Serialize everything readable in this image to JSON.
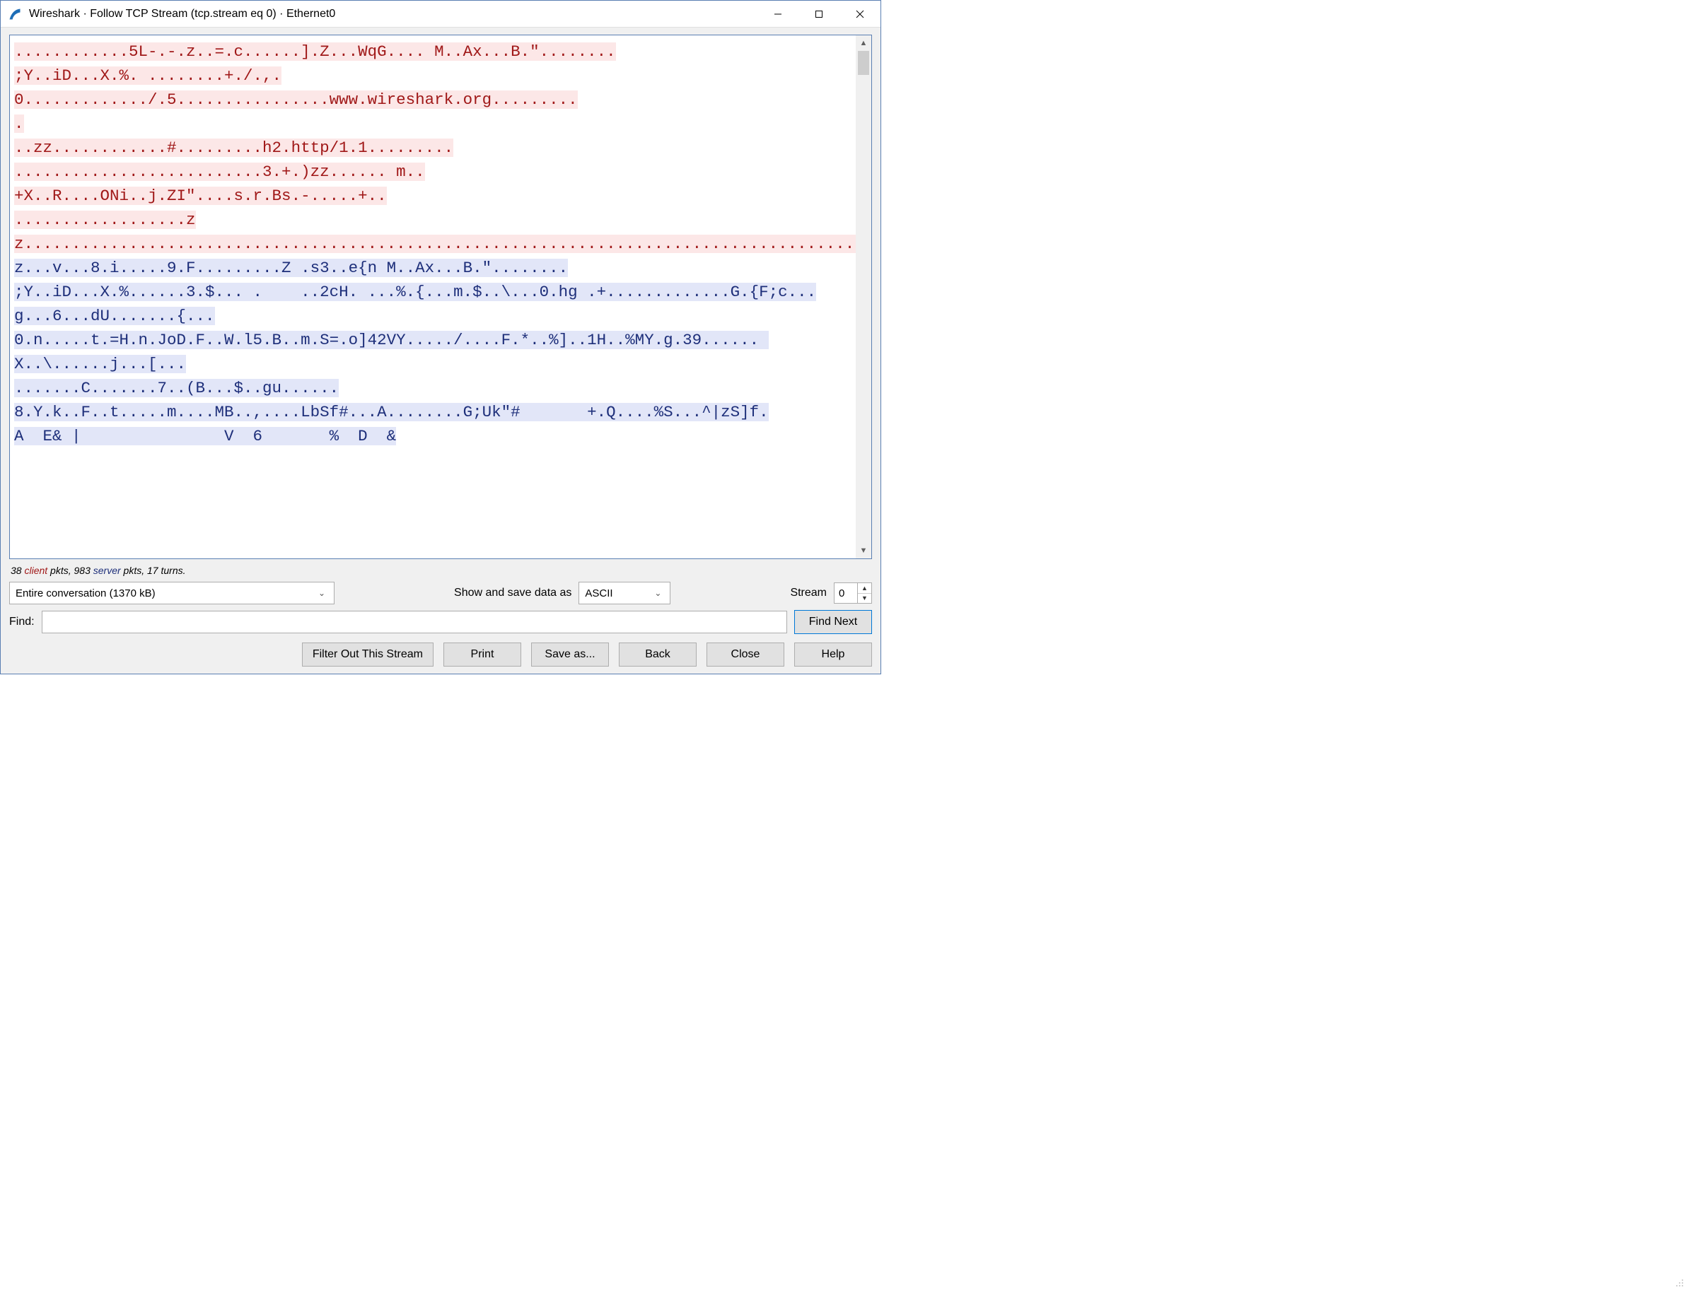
{
  "title": "Wireshark · Follow TCP Stream (tcp.stream eq 0) · Ethernet0",
  "stream_segments": [
    {
      "role": "cli",
      "text": "............5L-.-.z..=.c......].Z...WqG.... M..Ax...B.\"........"
    },
    {
      "role": "txt",
      "text": "\n"
    },
    {
      "role": "cli",
      "text": ";Y..iD...X.%. ........+./.,."
    },
    {
      "role": "txt",
      "text": "\n"
    },
    {
      "role": "cli",
      "text": "0............./.5................www.wireshark.org........."
    },
    {
      "role": "txt",
      "text": "\n"
    },
    {
      "role": "cli",
      "text": "."
    },
    {
      "role": "txt",
      "text": "\n"
    },
    {
      "role": "cli",
      "text": "..zz............#.........h2.http/1.1........."
    },
    {
      "role": "txt",
      "text": "\n"
    },
    {
      "role": "cli",
      "text": "..........................3.+.)zz...... m.."
    },
    {
      "role": "txt",
      "text": "\n"
    },
    {
      "role": "cli",
      "text": "+X..R....ONi..j.ZI\"....s.r.Bs.-.....+.."
    },
    {
      "role": "txt",
      "text": "\n"
    },
    {
      "role": "cli",
      "text": "..................zz......................................................................................................................................................................................................................................."
    },
    {
      "role": "srv",
      "text": "....z...v...8.i.....9.F.........Z .s3..e{n M..Ax...B.\"........"
    },
    {
      "role": "txt",
      "text": "\n"
    },
    {
      "role": "srv",
      "text": ";Y..iD...X.%......3.$... .    ..2cH. ...%.{...m.$..\\...0.hg .+.............G.{F;c...g...6...dU.......{..."
    },
    {
      "role": "txt",
      "text": "\n"
    },
    {
      "role": "srv",
      "text": "0.n.....t.=H.n.JoD.F..W.l5.B..m.S=.o]42VY...../....F.*..%]..1H..%MY.g.39...... X..\\......j...[..."
    },
    {
      "role": "txt",
      "text": "\n"
    },
    {
      "role": "srv",
      "text": ".......C.......7..(B...$..gu......"
    },
    {
      "role": "txt",
      "text": "\n"
    },
    {
      "role": "srv",
      "text": "8.Y.k..F..t.....m....MB..,....LbSf#...A........G;Uk\"#       +.Q....%S...^|zS]f."
    },
    {
      "role": "txt",
      "text": "\n"
    },
    {
      "role": "srv",
      "text": "A  E& |               V  6       %  D  &"
    }
  ],
  "stats": {
    "client_pkts": 38,
    "client_word": "client",
    "middle1": " pkts, ",
    "server_pkts": 983,
    "server_word": "server",
    "tail": " pkts, 17 turns."
  },
  "conversation_combo": "Entire conversation (1370 kB)",
  "show_save_label": "Show and save data as",
  "format_combo": "ASCII",
  "stream_label": "Stream",
  "stream_value": "0",
  "find_label": "Find:",
  "find_value": "",
  "buttons": {
    "find_next": "Find Next",
    "filter_out": "Filter Out This Stream",
    "print": "Print",
    "save_as": "Save as...",
    "back": "Back",
    "close": "Close",
    "help": "Help"
  }
}
